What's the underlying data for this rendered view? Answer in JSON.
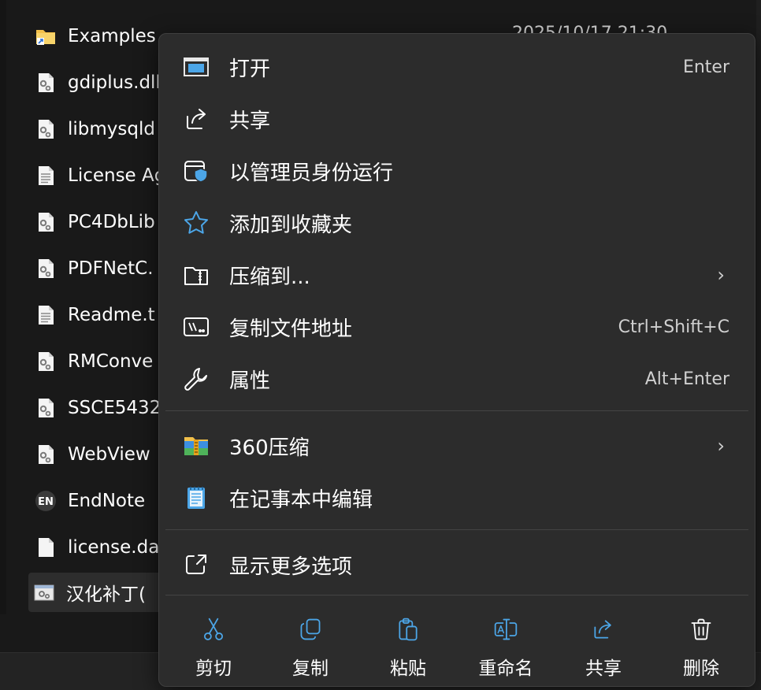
{
  "file_list": {
    "date_text": "2025/10/17 21:30",
    "items": [
      {
        "name": "Examples",
        "icon": "folder-shortcut-icon"
      },
      {
        "name": "gdiplus.dll",
        "icon": "dll-file-icon"
      },
      {
        "name": "libmysqld",
        "icon": "dll-file-icon"
      },
      {
        "name": "License Ag",
        "icon": "text-file-icon"
      },
      {
        "name": "PC4DbLib",
        "icon": "dll-file-icon"
      },
      {
        "name": "PDFNetC.",
        "icon": "dll-file-icon"
      },
      {
        "name": "Readme.t",
        "icon": "text-file-icon"
      },
      {
        "name": "RMConve",
        "icon": "dll-file-icon"
      },
      {
        "name": "SSCE5432",
        "icon": "dll-file-icon"
      },
      {
        "name": "WebView",
        "icon": "dll-file-icon"
      },
      {
        "name": "EndNote",
        "icon": "endnote-en-icon"
      },
      {
        "name": "license.da",
        "icon": "blank-file-icon"
      },
      {
        "name": "汉化补丁(",
        "icon": "patch-exe-icon"
      }
    ]
  },
  "context_menu": {
    "items": [
      {
        "label": "打开",
        "shortcut": "Enter",
        "icon": "open-window-icon"
      },
      {
        "label": "共享",
        "shortcut": "",
        "icon": "share-icon"
      },
      {
        "label": "以管理员身份运行",
        "shortcut": "",
        "icon": "run-as-admin-shield-icon"
      },
      {
        "label": "添加到收藏夹",
        "shortcut": "",
        "icon": "star-icon"
      },
      {
        "label": "压缩到...",
        "shortcut": "",
        "icon": "zip-folder-icon",
        "submenu": true
      },
      {
        "label": "复制文件地址",
        "shortcut": "Ctrl+Shift+C",
        "icon": "copy-path-icon"
      },
      {
        "label": "属性",
        "shortcut": "Alt+Enter",
        "icon": "wrench-icon"
      }
    ],
    "third_party": [
      {
        "label": "360压缩",
        "icon": "360-zip-icon",
        "submenu": true
      },
      {
        "label": "在记事本中编辑",
        "icon": "notepad-icon"
      }
    ],
    "more_options": {
      "label": "显示更多选项",
      "icon": "show-more-icon"
    },
    "toolbar": [
      {
        "label": "剪切",
        "icon": "cut-scissors-icon"
      },
      {
        "label": "复制",
        "icon": "copy-icon"
      },
      {
        "label": "粘贴",
        "icon": "paste-clipboard-icon"
      },
      {
        "label": "重命名",
        "icon": "rename-icon"
      },
      {
        "label": "共享",
        "icon": "share-icon"
      },
      {
        "label": "删除",
        "icon": "trash-icon"
      }
    ],
    "chevron": "›"
  },
  "colors": {
    "menu_bg": "#2c2c2c",
    "accent_blue": "#4ca6e8",
    "folder_yellow": "#f2c04a"
  }
}
